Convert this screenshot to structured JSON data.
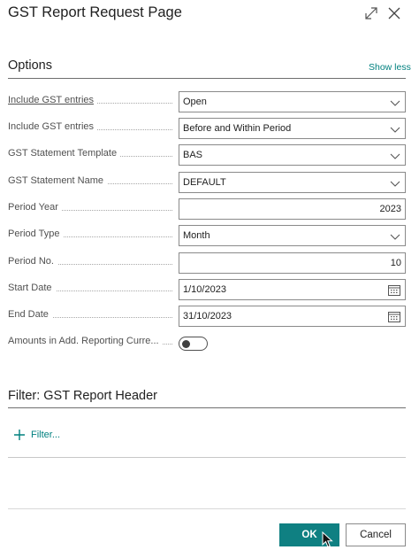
{
  "dialog": {
    "title": "GST Report Request Page"
  },
  "options": {
    "heading": "Options",
    "show_less": "Show less",
    "fields": [
      {
        "label": "Include GST entries",
        "value": "Open",
        "type": "select"
      },
      {
        "label": "Include GST entries",
        "value": "Before and Within Period",
        "type": "select"
      },
      {
        "label": "GST Statement Template",
        "value": "BAS",
        "type": "select"
      },
      {
        "label": "GST Statement Name",
        "value": "DEFAULT",
        "type": "select"
      },
      {
        "label": "Period Year",
        "value": "2023",
        "type": "number"
      },
      {
        "label": "Period Type",
        "value": "Month",
        "type": "select"
      },
      {
        "label": "Period No.",
        "value": "10",
        "type": "number"
      },
      {
        "label": "Start Date",
        "value": "1/10/2023",
        "type": "date"
      },
      {
        "label": "End Date",
        "value": "31/10/2023",
        "type": "date"
      },
      {
        "label": "Amounts in Add. Reporting Curre...",
        "value": false,
        "type": "toggle"
      }
    ]
  },
  "filter_section": {
    "heading": "Filter: GST Report Header",
    "filter_link": "Filter..."
  },
  "footer": {
    "ok_label": "OK",
    "cancel_label": "Cancel"
  },
  "colors": {
    "accent": "#0f8082",
    "link": "#00807f"
  }
}
